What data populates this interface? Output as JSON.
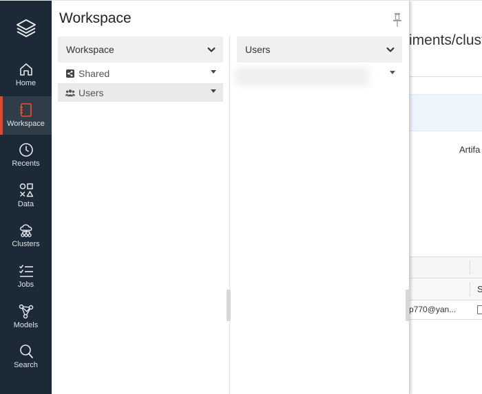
{
  "nav": {
    "items": [
      {
        "label": "Home",
        "icon": "home-icon"
      },
      {
        "label": "Workspace",
        "icon": "workspace-icon"
      },
      {
        "label": "Recents",
        "icon": "clock-icon"
      },
      {
        "label": "Data",
        "icon": "shapes-icon"
      },
      {
        "label": "Clusters",
        "icon": "cluster-icon"
      },
      {
        "label": "Jobs",
        "icon": "checklist-icon"
      },
      {
        "label": "Models",
        "icon": "model-icon"
      },
      {
        "label": "Search",
        "icon": "search-icon"
      }
    ],
    "active": "Workspace",
    "accent_color": "#e0492f",
    "background_color": "#1b2a36"
  },
  "flyout": {
    "title": "Workspace",
    "column1": {
      "header": "Workspace",
      "items": [
        {
          "label": "Shared",
          "icon": "shared-folder-icon"
        },
        {
          "label": "Users",
          "icon": "users-icon",
          "selected": true
        }
      ]
    },
    "column2": {
      "header": "Users"
    }
  },
  "background_page": {
    "title_fragment": "iments/clust",
    "artifacts_fragment": "Artifa",
    "column_fragment": "S",
    "email_fragment": "p770@yan..."
  }
}
